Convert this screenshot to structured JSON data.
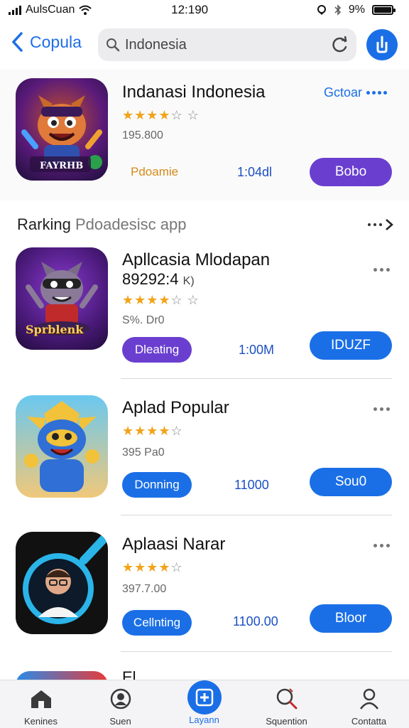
{
  "status_bar": {
    "carrier": "AulsCuan",
    "time": "12:190",
    "battery": "9%"
  },
  "nav": {
    "back_label": "Copula",
    "search_text": "Indonesia"
  },
  "featured": {
    "title": "Indanasi Indonesia",
    "link_label": "Gctoar",
    "rating_stars": 3.5,
    "rating_text": "★★★★☆ ☆",
    "meta": "195.800",
    "category": "Pdoamie",
    "count": "1:04dl",
    "button": "Bobo",
    "icon_label": "FAYRHB"
  },
  "section": {
    "title_a": "Rarking",
    "title_b": "Pdoadesisc app"
  },
  "apps": [
    {
      "title": "Apllcasia Mlodapan",
      "subtitle": "89292:4 ",
      "stars": "★★★★☆ ",
      "meta": "S%. Dr0",
      "tag": "Dleating",
      "count": "1:00M",
      "button": "IDUZF",
      "icon_label": "Sprblenk"
    },
    {
      "title": "Aplad  Popular",
      "stars": "★★★★☆ ",
      "meta": "395 Pa0",
      "tag": "Donning",
      "count": "11000",
      "button": "Sou0"
    },
    {
      "title": "Aplaasi Narar",
      "stars": "★★★★☆",
      "meta": "397.7.00",
      "tag": "Cellnting",
      "count": "1100.00",
      "button": "Bloor"
    }
  ],
  "peek_title": "El",
  "tabs": [
    {
      "label": "Kenines",
      "icon": "home-icon"
    },
    {
      "label": "Suen",
      "icon": "search-profile-icon"
    },
    {
      "label": "Layann",
      "icon": "apps-icon",
      "active": true
    },
    {
      "label": "Squention",
      "icon": "magnifier-icon"
    },
    {
      "label": "Contatta",
      "icon": "person-icon"
    }
  ],
  "colors": {
    "accent": "#1a6fe6",
    "star": "#f2a31a",
    "purple": "#6a3fd0",
    "orange": "#d68a1a"
  }
}
